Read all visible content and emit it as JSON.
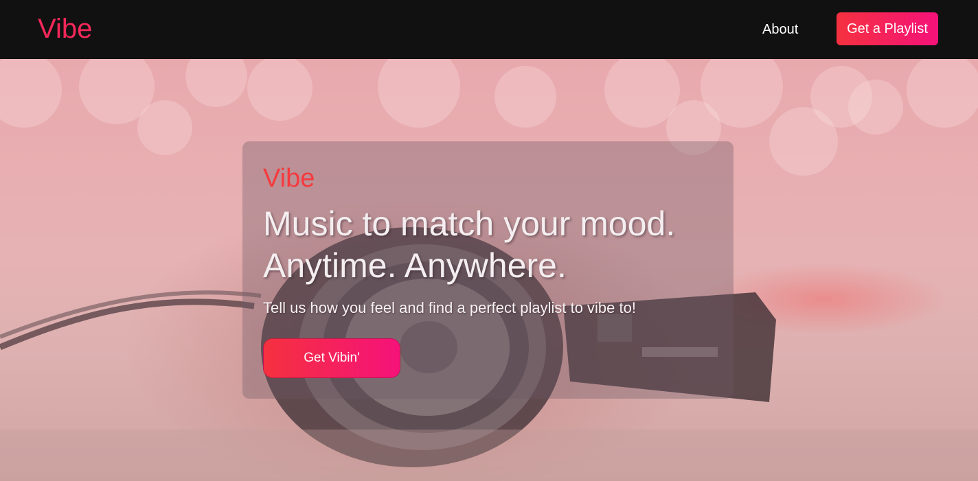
{
  "navbar": {
    "brand": "Vibe",
    "about_label": "About",
    "cta_label": "Get a Playlist"
  },
  "hero": {
    "card": {
      "brand": "Vibe",
      "headline": "Music to match your mood. Anytime. Anywhere.",
      "subheadline": "Tell us how you feel and find a perfect playlist to vibe to!",
      "cta_label": "Get Vibin'"
    }
  },
  "colors": {
    "navbar_bg": "#111111",
    "brand_accent": "#f5285a",
    "button_gradient_start": "#f5313f",
    "button_gradient_end": "#f5127a"
  }
}
